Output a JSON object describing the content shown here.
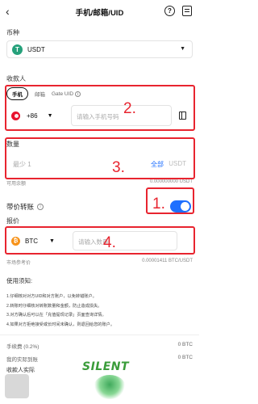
{
  "header": {
    "title": "手机/邮箱/UID",
    "back_glyph": "‹",
    "help_glyph": "?"
  },
  "currency": {
    "label": "币种",
    "value": "USDT",
    "icon_letter": "T"
  },
  "recipient": {
    "label": "收款人",
    "tabs": [
      {
        "label": "手机",
        "active": true
      },
      {
        "label": "邮箱",
        "active": false
      },
      {
        "label": "Gate UID",
        "active": false
      }
    ],
    "uid_info_glyph": "i",
    "country_code": "+86",
    "phone_placeholder": "请输入手机号码"
  },
  "amount": {
    "label": "数量",
    "placeholder": "最少 1",
    "all_label": "全部",
    "unit": "USDT",
    "available_label": "可用余额",
    "available_value": "0.000000000 USDT"
  },
  "priced_transfer": {
    "label": "带价转账",
    "enabled": true,
    "info_glyph": "i"
  },
  "quote": {
    "label": "报价",
    "coin": "BTC",
    "coin_icon_letter": "₿",
    "placeholder": "请输入数量",
    "reference_label": "市场参考价",
    "reference_value": "0.00001411 BTC/USDT"
  },
  "notes": {
    "title": "使用须知:",
    "lines": [
      "1.仔细核对对方UID和对方账户，以免转错账户。",
      "2.转账时仔细核对转账数量和金额，防止造成损失。",
      "3.对方确认后可以在「充值提现记录」页面查询详情。",
      "4.如果对方拒绝接受或长时间未确认，则退回给您的账户。"
    ]
  },
  "summary": {
    "fee_label": "手续费 (0.2%)",
    "fee_value": "0 BTC",
    "actual_label": "我的实际到账",
    "actual_value": "0 BTC",
    "payee_label": "收款人实际"
  },
  "annotations": {
    "box1": "1.",
    "box2": "2.",
    "box3": "3.",
    "box4": "4."
  },
  "watermark": {
    "text": "SILENT"
  },
  "colors": {
    "accent": "#1e6fff",
    "highlight": "#e8242f",
    "tether": "#26a17b",
    "btc": "#f7931a"
  }
}
